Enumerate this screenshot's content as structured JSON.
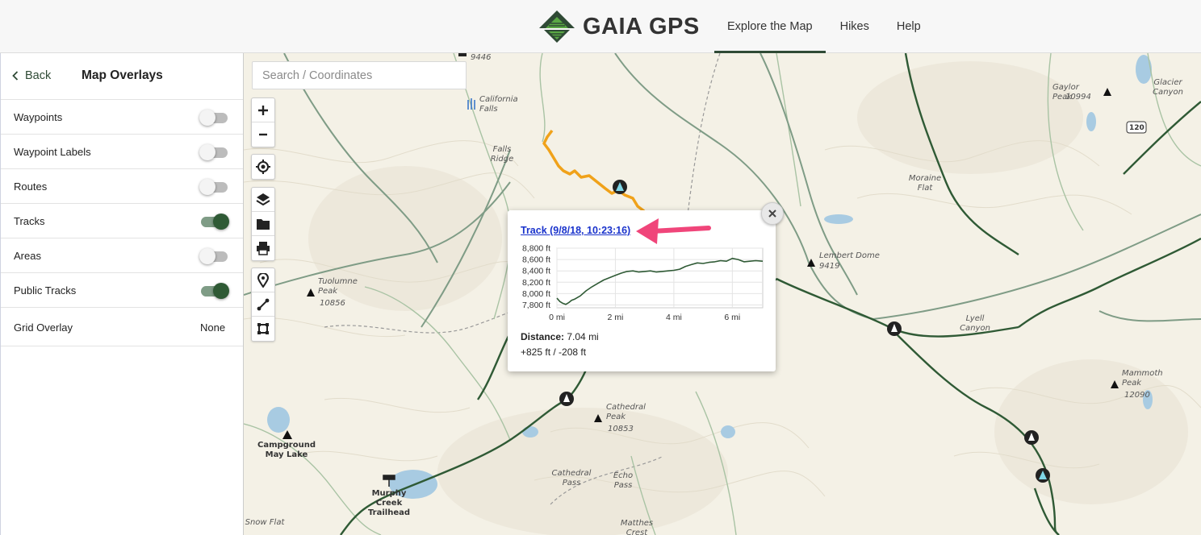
{
  "header": {
    "brand": "GAIA GPS",
    "nav": [
      "Explore the Map",
      "Hikes",
      "Help"
    ],
    "active_nav": "Explore the Map"
  },
  "sidebar": {
    "back_label": "Back",
    "title": "Map Overlays",
    "items": [
      {
        "label": "Waypoints",
        "on": false
      },
      {
        "label": "Waypoint Labels",
        "on": false
      },
      {
        "label": "Routes",
        "on": false
      },
      {
        "label": "Tracks",
        "on": true
      },
      {
        "label": "Areas",
        "on": false
      },
      {
        "label": "Public Tracks",
        "on": true
      }
    ],
    "grid_overlay": {
      "label": "Grid Overlay",
      "value": "None"
    }
  },
  "search": {
    "placeholder": "Search / Coordinates"
  },
  "map_labels": {
    "california_falls": "California Falls",
    "falls_ridge": "Falls Ridge",
    "moraine_flat": "Moraine Flat",
    "gaylor_peak": "Gaylor Peak",
    "gaylor_peak_elev": "10994",
    "glacier_canyon": "Glacier Canyon",
    "route_120": "120",
    "lembert_dome": "Lembert Dome",
    "lembert_dome_elev": "9419",
    "tuolumne_peak": "Tuolumne Peak",
    "tuolumne_peak_elev": "10856",
    "lyell_canyon": "Lyell Canyon",
    "mammoth_peak": "Mammoth Peak",
    "mammoth_peak_elev": "12090",
    "cathedral_peak": "Cathedral Peak",
    "cathedral_peak_elev": "10853",
    "campground_may_lake": "Campground May Lake",
    "murphy_creek": "Murphy Creek Trailhead",
    "cathedral_pass": "Cathedral Pass",
    "echo_pass": "Echo Pass",
    "snow_flat": "Snow Flat",
    "matthes_crest": "Matthes Crest",
    "top_elev": "9446"
  },
  "popup": {
    "title": "Track (9/8/18, 10:23:16)",
    "distance_label": "Distance:",
    "distance_value": "7.04 mi",
    "elevation_change": "+825 ft / -208 ft"
  },
  "chart_data": {
    "type": "line",
    "title": "",
    "xlabel": "",
    "ylabel": "",
    "y_ticks": [
      "8,800 ft",
      "8,600 ft",
      "8,400 ft",
      "8,200 ft",
      "8,000 ft",
      "7,800 ft"
    ],
    "x_ticks": [
      "0 mi",
      "2 mi",
      "4 mi",
      "6 mi"
    ],
    "xlim": [
      0,
      7.04
    ],
    "ylim": [
      7750,
      8800
    ],
    "series": [
      {
        "color": "#2f5a35",
        "x": [
          0,
          0.1,
          0.2,
          0.3,
          0.4,
          0.5,
          0.6,
          0.8,
          1.0,
          1.2,
          1.4,
          1.6,
          1.8,
          2.0,
          2.2,
          2.4,
          2.6,
          2.8,
          3.0,
          3.2,
          3.4,
          3.6,
          3.8,
          4.0,
          4.2,
          4.4,
          4.6,
          4.8,
          5.0,
          5.2,
          5.4,
          5.6,
          5.8,
          6.0,
          6.2,
          6.4,
          6.6,
          6.8,
          7.04
        ],
        "y": [
          7920,
          7860,
          7830,
          7810,
          7840,
          7880,
          7900,
          7960,
          8050,
          8120,
          8180,
          8240,
          8280,
          8320,
          8360,
          8390,
          8400,
          8380,
          8390,
          8400,
          8380,
          8390,
          8400,
          8410,
          8430,
          8480,
          8510,
          8540,
          8530,
          8550,
          8560,
          8580,
          8570,
          8620,
          8600,
          8560,
          8570,
          8580,
          8570
        ]
      }
    ]
  }
}
